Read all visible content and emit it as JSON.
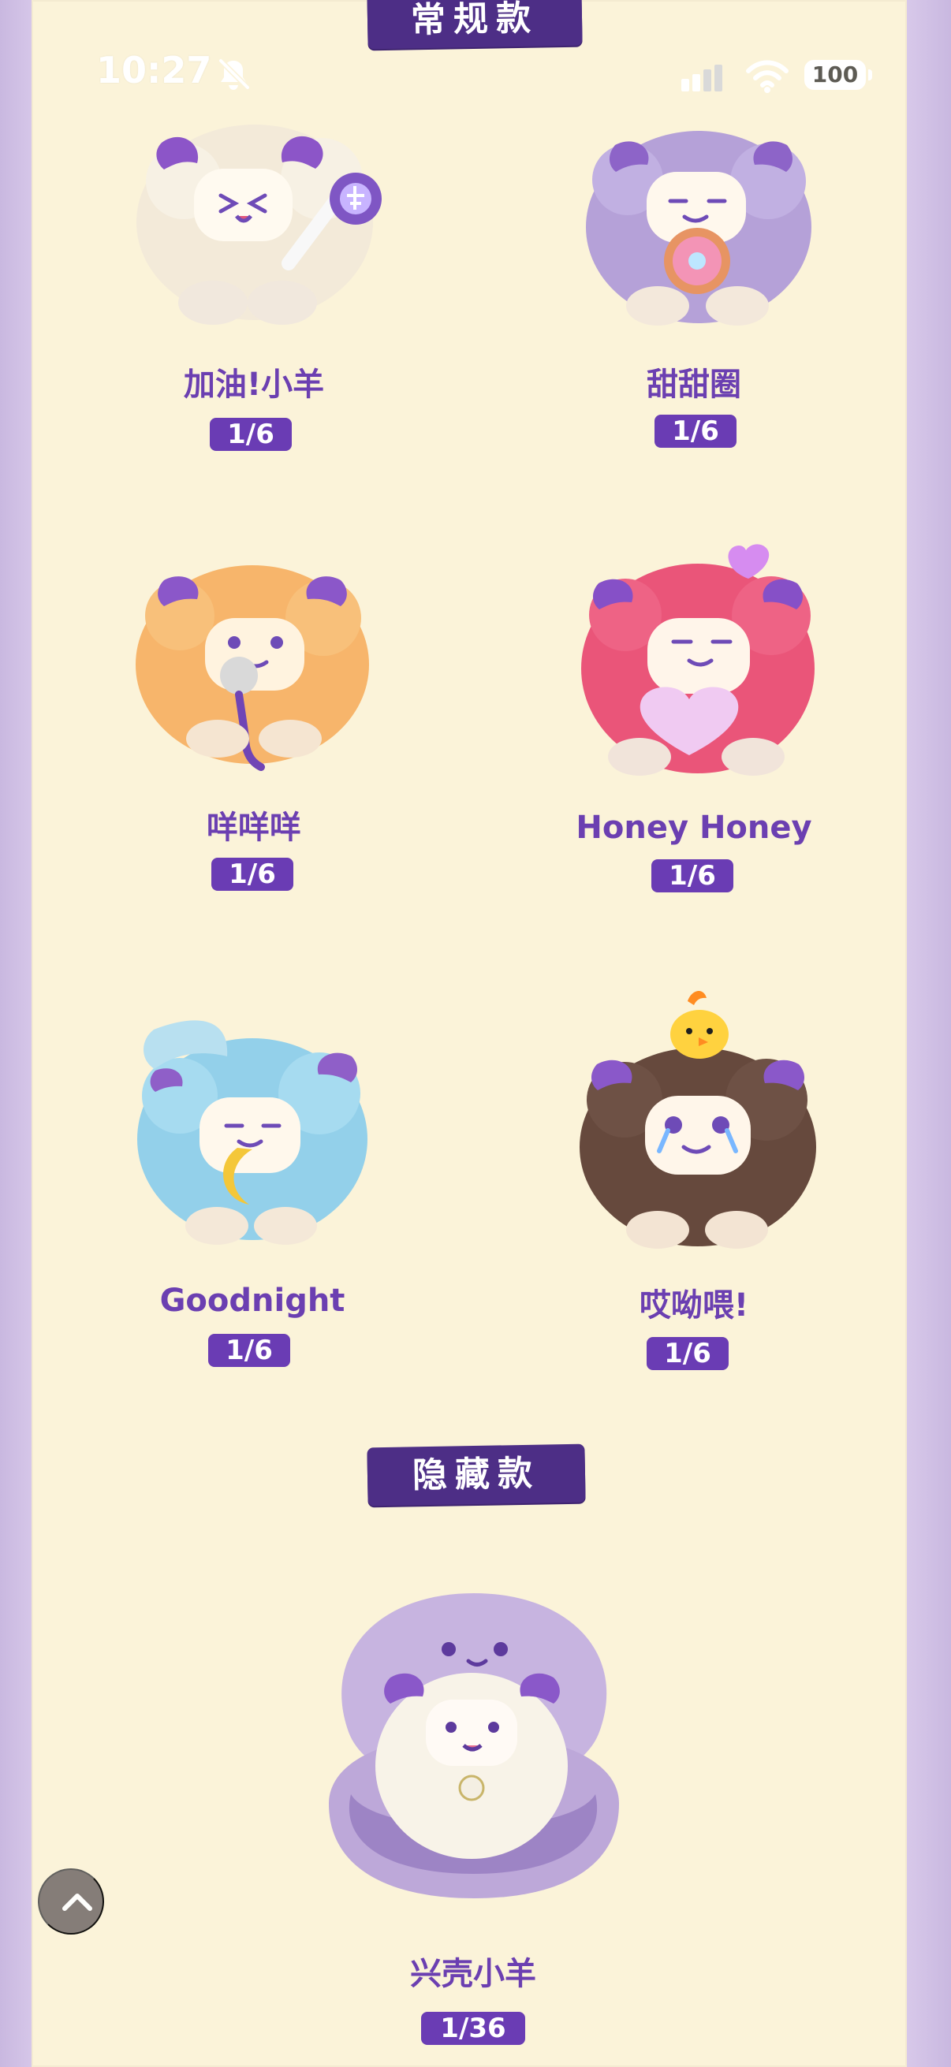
{
  "status_bar": {
    "time": "10:27",
    "battery": "100",
    "icons": [
      "bell-off-icon",
      "signal-icon",
      "wifi-icon",
      "battery-icon"
    ]
  },
  "sections": {
    "regular": "常规款",
    "hidden": "隐藏款"
  },
  "items": [
    {
      "name": "加油!小羊",
      "odds": "1/6",
      "color": "#f3ead9",
      "accessory": "light-stick"
    },
    {
      "name": "甜甜圈",
      "odds": "1/6",
      "color": "#b5a1d8",
      "accessory": "donut"
    },
    {
      "name": "咩咩咩",
      "odds": "1/6",
      "color": "#f7b56b",
      "accessory": "microphone"
    },
    {
      "name": "Honey Honey",
      "odds": "1/6",
      "color": "#ea5579",
      "accessory": "heart"
    },
    {
      "name": "Goodnight",
      "odds": "1/6",
      "color": "#93d0ea",
      "accessory": "moon"
    },
    {
      "name": "哎呦喂!",
      "odds": "1/6",
      "color": "#66493d",
      "accessory": "chick"
    },
    {
      "name": "兴壳小羊",
      "odds": "1/36",
      "color": "#c7b4e0",
      "accessory": "shell"
    }
  ],
  "controls": {
    "back_to_top": "chevron-up-icon"
  }
}
